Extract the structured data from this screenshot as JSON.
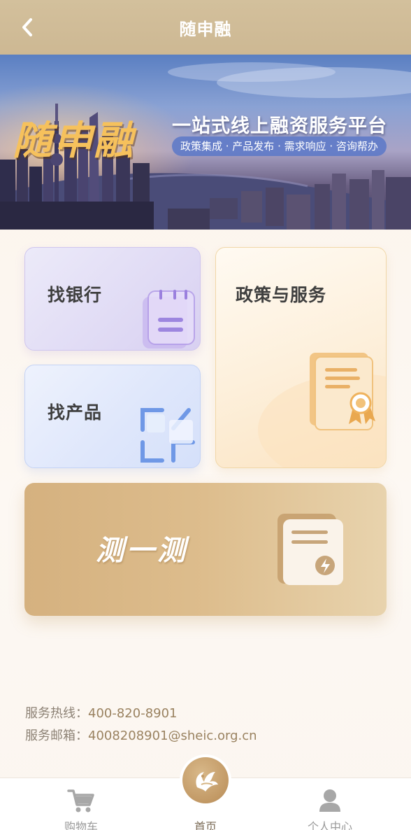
{
  "header": {
    "title": "随申融",
    "back_icon": "chevron-left-icon"
  },
  "banner": {
    "brand": "随申融",
    "slogan": "一站式线上融资服务平台",
    "tags": "政策集成 · 产品发布 · 需求响应 · 咨询帮办"
  },
  "cards": {
    "bank": {
      "label": "找银行",
      "icon": "clipboard-icon"
    },
    "product": {
      "label": "找产品",
      "icon": "grid-icon"
    },
    "policy": {
      "label": "政策与服务",
      "icon": "certificate-icon"
    },
    "test": {
      "label": "测一测",
      "icon": "document-lightning-icon"
    }
  },
  "contact": {
    "hotline_label": "服务热线：",
    "hotline_value": "400-820-8901",
    "email_label": "服务邮箱：",
    "email_value": "4008208901@sheic.org.cn"
  },
  "tabbar": {
    "items": [
      {
        "label": "购物车",
        "icon": "cart-icon"
      },
      {
        "label": "首页",
        "icon": "phoenix-logo-icon"
      },
      {
        "label": "个人中心",
        "icon": "person-icon"
      }
    ]
  },
  "colors": {
    "header_bg": "#cfbb96",
    "brand_gold": "#f6c15c",
    "test_card": "#d8b582",
    "text_dark": "#3f3f3f"
  }
}
